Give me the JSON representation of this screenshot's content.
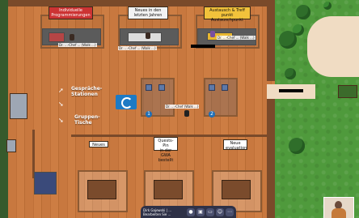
{
  "signs": {
    "individuelle": "Individuelle\nProgrammierungen",
    "neues": "Neues in den\nletzten Jahren",
    "austausch": "Austausch & Treff\npunkt Austauschpunkt",
    "quests": "Quests-Pin\nin der GWA\nbestellt",
    "neues_bottom": "Neues",
    "neue_evaluation": "Neue\nevaluation"
  },
  "floor_text": {
    "stations": "Gespräche-\nStationen",
    "gruppen": "Gruppen-\nTische"
  },
  "badges": [
    "1",
    "2"
  ],
  "name_labels": {
    "top_left": "Dr. ...-Chef ... (Walk ...)",
    "top_mid_a": "Dr. ...-Chef ... (Walk ...)",
    "top_mid_b": "Dr. ...-Chef ... (Walk ...)",
    "top_right": "Dr. ...-Chef ... (Walk ...)",
    "center": "Dr. ...-Chef (Walk ...)"
  },
  "toolbar": {
    "user_name": "Dirk Gajewski | ...",
    "user_status": "Bearbeiten Sie ...",
    "buttons": [
      "mic-icon",
      "camera-icon",
      "screen-share-icon",
      "emoji-icon",
      "more-icon"
    ]
  },
  "colors": {
    "floor": "#c8783f",
    "grass": "#4f9a3c",
    "toolbar": "#2e3147",
    "accent_blue": "#1d7ac4"
  }
}
